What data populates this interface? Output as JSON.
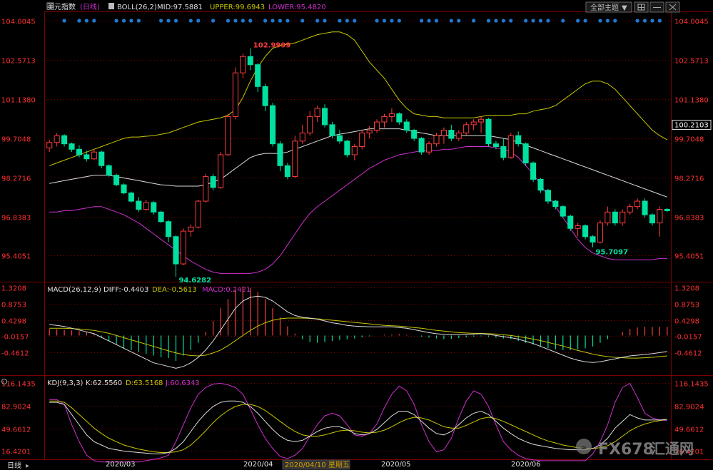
{
  "header": {
    "symbol": "美元指数",
    "period": "日线",
    "boll_label": "BOLL(26,2)",
    "mid_label": "MID:97.5881",
    "upper_label": "UPPER:99.6943",
    "lower_label": "LOWER:95.4820",
    "theme_button": "全部主题"
  },
  "colors": {
    "up": "#ff3d3d",
    "down": "#00e0a0",
    "upper": "#c8c800",
    "mid": "#dcdcdc",
    "lower": "#d030d0",
    "axis": "#ff3030",
    "grid": "#7a0000"
  },
  "chart_data": [
    {
      "type": "candlestick",
      "name": "price",
      "ylim": [
        94.5,
        104.3
      ],
      "y_ticks": [
        "104.0045",
        "102.5713",
        "101.1380",
        "99.7048",
        "98.2716",
        "96.8383",
        "95.4051"
      ],
      "current_price": "100.2103",
      "annotations": {
        "high": "102.9999",
        "low": "94.6282",
        "low2": "95.7097"
      },
      "ohlc": [
        [
          99.35,
          99.65,
          99.2,
          99.55
        ],
        [
          99.55,
          99.9,
          99.4,
          99.8
        ],
        [
          99.8,
          99.85,
          99.4,
          99.5
        ],
        [
          99.5,
          99.55,
          99.2,
          99.3
        ],
        [
          99.3,
          99.45,
          99.0,
          99.1
        ],
        [
          99.1,
          99.25,
          98.85,
          98.95
        ],
        [
          98.95,
          99.3,
          98.9,
          99.2
        ],
        [
          99.2,
          99.25,
          98.6,
          98.7
        ],
        [
          98.7,
          98.75,
          98.3,
          98.35
        ],
        [
          98.35,
          98.4,
          97.95,
          98.0
        ],
        [
          98.0,
          98.05,
          97.65,
          97.7
        ],
        [
          97.7,
          97.75,
          97.35,
          97.4
        ],
        [
          97.4,
          97.55,
          97.0,
          97.1
        ],
        [
          97.1,
          97.45,
          97.05,
          97.35
        ],
        [
          97.35,
          97.4,
          96.9,
          97.0
        ],
        [
          97.0,
          97.05,
          96.6,
          96.65
        ],
        [
          96.65,
          96.7,
          95.9,
          96.1
        ],
        [
          96.1,
          96.15,
          94.63,
          95.1
        ],
        [
          95.1,
          96.4,
          95.05,
          96.3
        ],
        [
          96.3,
          96.55,
          96.1,
          96.45
        ],
        [
          96.45,
          97.45,
          96.4,
          97.4
        ],
        [
          97.4,
          98.4,
          97.35,
          98.3
        ],
        [
          98.3,
          98.4,
          97.8,
          97.9
        ],
        [
          97.9,
          99.2,
          97.85,
          99.1
        ],
        [
          99.1,
          100.6,
          99.05,
          100.5
        ],
        [
          100.5,
          102.3,
          100.4,
          102.1
        ],
        [
          102.1,
          102.8,
          101.9,
          102.7
        ],
        [
          102.7,
          103.0,
          102.2,
          102.4
        ],
        [
          102.4,
          102.45,
          101.4,
          101.6
        ],
        [
          101.6,
          101.7,
          100.7,
          100.9
        ],
        [
          100.9,
          101.0,
          99.4,
          99.5
        ],
        [
          99.5,
          99.6,
          98.5,
          98.7
        ],
        [
          98.7,
          98.8,
          98.2,
          98.3
        ],
        [
          98.3,
          99.8,
          98.25,
          99.6
        ],
        [
          99.6,
          100.2,
          99.5,
          99.9
        ],
        [
          99.9,
          100.7,
          99.8,
          100.5
        ],
        [
          100.5,
          100.9,
          100.3,
          100.8
        ],
        [
          100.8,
          100.95,
          100.1,
          100.2
        ],
        [
          100.2,
          100.3,
          99.7,
          99.8
        ],
        [
          99.8,
          100.0,
          99.5,
          99.6
        ],
        [
          99.6,
          99.65,
          99.0,
          99.1
        ],
        [
          99.1,
          99.5,
          98.9,
          99.4
        ],
        [
          99.4,
          100.0,
          99.3,
          99.9
        ],
        [
          99.9,
          100.15,
          99.7,
          100.0
        ],
        [
          100.0,
          100.4,
          99.9,
          100.3
        ],
        [
          100.3,
          100.6,
          100.1,
          100.5
        ],
        [
          100.5,
          100.8,
          100.3,
          100.6
        ],
        [
          100.6,
          100.65,
          100.2,
          100.3
        ],
        [
          100.3,
          100.4,
          99.9,
          100.0
        ],
        [
          100.0,
          100.05,
          99.6,
          99.7
        ],
        [
          99.7,
          99.75,
          99.1,
          99.2
        ],
        [
          99.2,
          99.6,
          99.1,
          99.5
        ],
        [
          99.5,
          99.9,
          99.4,
          99.8
        ],
        [
          99.8,
          100.1,
          99.5,
          100.0
        ],
        [
          100.0,
          100.2,
          99.6,
          99.7
        ],
        [
          99.7,
          100.0,
          99.6,
          99.9
        ],
        [
          99.9,
          100.3,
          99.8,
          100.2
        ],
        [
          100.2,
          100.4,
          100.0,
          100.3
        ],
        [
          100.3,
          100.5,
          99.9,
          100.4
        ],
        [
          100.4,
          100.45,
          99.4,
          99.5
        ],
        [
          99.5,
          99.6,
          99.3,
          99.4
        ],
        [
          99.4,
          99.7,
          98.9,
          99.0
        ],
        [
          99.0,
          99.9,
          98.95,
          99.8
        ],
        [
          99.8,
          99.95,
          99.4,
          99.5
        ],
        [
          99.5,
          99.55,
          98.7,
          98.8
        ],
        [
          98.8,
          98.85,
          98.1,
          98.2
        ],
        [
          98.2,
          98.25,
          97.7,
          97.8
        ],
        [
          97.8,
          97.85,
          97.3,
          97.4
        ],
        [
          97.4,
          97.45,
          97.1,
          97.2
        ],
        [
          97.2,
          97.25,
          96.8,
          96.85
        ],
        [
          96.85,
          96.9,
          96.3,
          96.4
        ],
        [
          96.4,
          96.6,
          96.1,
          96.5
        ],
        [
          96.5,
          96.55,
          96.0,
          96.1
        ],
        [
          96.1,
          96.15,
          95.71,
          95.9
        ],
        [
          95.9,
          96.7,
          95.85,
          96.6
        ],
        [
          96.6,
          97.2,
          96.5,
          97.0
        ],
        [
          97.0,
          97.1,
          96.5,
          96.6
        ],
        [
          96.6,
          97.1,
          96.5,
          97.0
        ],
        [
          97.0,
          97.3,
          96.9,
          97.2
        ],
        [
          97.2,
          97.5,
          97.1,
          97.4
        ],
        [
          97.4,
          97.5,
          96.8,
          96.9
        ],
        [
          96.9,
          96.95,
          96.5,
          96.6
        ],
        [
          96.6,
          97.2,
          96.1,
          97.1
        ],
        [
          97.1,
          97.15,
          97.0,
          97.05
        ]
      ],
      "boll_upper": [
        98.7,
        98.8,
        98.9,
        99.0,
        99.1,
        99.2,
        99.3,
        99.4,
        99.5,
        99.6,
        99.7,
        99.75,
        99.75,
        99.78,
        99.8,
        99.85,
        99.9,
        100.0,
        100.1,
        100.2,
        100.3,
        100.35,
        100.4,
        100.45,
        100.55,
        100.75,
        101.2,
        101.8,
        102.3,
        102.7,
        103.0,
        103.1,
        103.15,
        103.2,
        103.3,
        103.4,
        103.5,
        103.55,
        103.6,
        103.6,
        103.5,
        103.3,
        102.9,
        102.5,
        102.2,
        101.9,
        101.5,
        101.1,
        100.8,
        100.6,
        100.55,
        100.5,
        100.5,
        100.45,
        100.45,
        100.45,
        100.45,
        100.45,
        100.5,
        100.55,
        100.55,
        100.55,
        100.55,
        100.6,
        100.6,
        100.7,
        100.75,
        100.8,
        100.9,
        101.1,
        101.3,
        101.5,
        101.7,
        101.8,
        101.8,
        101.7,
        101.5,
        101.2,
        100.9,
        100.6,
        100.3,
        100.0,
        99.8,
        99.65
      ],
      "boll_mid": [
        98.05,
        98.1,
        98.15,
        98.2,
        98.25,
        98.3,
        98.35,
        98.35,
        98.35,
        98.3,
        98.25,
        98.2,
        98.15,
        98.1,
        98.05,
        98.0,
        97.98,
        97.95,
        97.95,
        97.95,
        97.95,
        98.0,
        98.1,
        98.2,
        98.4,
        98.6,
        98.8,
        99.0,
        99.1,
        99.15,
        99.15,
        99.15,
        99.2,
        99.3,
        99.4,
        99.5,
        99.6,
        99.7,
        99.8,
        99.85,
        99.9,
        99.95,
        100.0,
        100.05,
        100.05,
        100.05,
        100.05,
        100.05,
        100.0,
        99.95,
        99.9,
        99.85,
        99.8,
        99.8,
        99.8,
        99.8,
        99.8,
        99.8,
        99.8,
        99.8,
        99.75,
        99.7,
        99.65,
        99.55,
        99.45,
        99.35,
        99.25,
        99.15,
        99.05,
        98.95,
        98.85,
        98.75,
        98.65,
        98.55,
        98.45,
        98.35,
        98.25,
        98.15,
        98.05,
        97.95,
        97.85,
        97.75,
        97.65,
        97.55
      ],
      "boll_lower": [
        97.0,
        97.0,
        97.05,
        97.05,
        97.1,
        97.15,
        97.2,
        97.2,
        97.1,
        97.0,
        96.9,
        96.75,
        96.6,
        96.4,
        96.2,
        96.0,
        95.8,
        95.6,
        95.4,
        95.2,
        95.05,
        94.9,
        94.8,
        94.75,
        94.75,
        94.75,
        94.75,
        94.75,
        94.8,
        94.9,
        95.1,
        95.4,
        95.8,
        96.2,
        96.6,
        96.95,
        97.2,
        97.4,
        97.6,
        97.8,
        98.0,
        98.2,
        98.4,
        98.6,
        98.75,
        98.9,
        99.0,
        99.1,
        99.15,
        99.2,
        99.25,
        99.25,
        99.25,
        99.3,
        99.3,
        99.35,
        99.4,
        99.4,
        99.4,
        99.4,
        99.35,
        99.3,
        99.2,
        99.0,
        98.7,
        98.4,
        98.0,
        97.6,
        97.2,
        96.8,
        96.4,
        96.0,
        95.7,
        95.5,
        95.4,
        95.3,
        95.25,
        95.25,
        95.25,
        95.25,
        95.25,
        95.25,
        95.3,
        95.3
      ]
    },
    {
      "type": "macd",
      "label": "MACD(26,12,9)",
      "diff_label": "DIFF:-0.4403",
      "dea_label": "DEA:-0.5613",
      "macd_label": "MACD:0.2421",
      "ylim": [
        -1.05,
        1.42
      ],
      "y_ticks": [
        "1.3208",
        "0.8753",
        "0.4298",
        "-0.0157",
        "-0.4612"
      ],
      "hist": [
        0.18,
        0.17,
        0.16,
        0.14,
        0.12,
        0.1,
        0.05,
        -0.05,
        -0.15,
        -0.25,
        -0.35,
        -0.4,
        -0.45,
        -0.5,
        -0.55,
        -0.6,
        -0.62,
        -0.7,
        -0.55,
        -0.4,
        -0.2,
        0.1,
        0.4,
        0.75,
        1.0,
        1.25,
        1.35,
        1.3,
        1.2,
        1.0,
        0.75,
        0.5,
        0.25,
        0.05,
        -0.1,
        -0.18,
        -0.2,
        -0.18,
        -0.15,
        -0.12,
        -0.1,
        -0.08,
        -0.05,
        -0.02,
        0.0,
        0.02,
        0.03,
        0.04,
        0.02,
        0.0,
        -0.03,
        -0.06,
        -0.08,
        -0.1,
        -0.09,
        -0.07,
        -0.05,
        -0.03,
        -0.02,
        -0.04,
        -0.06,
        -0.08,
        -0.1,
        -0.15,
        -0.2,
        -0.25,
        -0.3,
        -0.35,
        -0.38,
        -0.4,
        -0.4,
        -0.38,
        -0.35,
        -0.3,
        -0.2,
        -0.1,
        0.0,
        0.1,
        0.18,
        0.22,
        0.24,
        0.24,
        0.24,
        0.24
      ],
      "diff": [
        0.3,
        0.28,
        0.25,
        0.2,
        0.15,
        0.1,
        0.05,
        -0.05,
        -0.15,
        -0.25,
        -0.35,
        -0.45,
        -0.55,
        -0.65,
        -0.75,
        -0.8,
        -0.85,
        -0.9,
        -0.85,
        -0.75,
        -0.6,
        -0.4,
        -0.15,
        0.15,
        0.45,
        0.75,
        0.95,
        1.05,
        1.08,
        1.05,
        0.95,
        0.8,
        0.65,
        0.55,
        0.5,
        0.48,
        0.45,
        0.4,
        0.35,
        0.32,
        0.28,
        0.26,
        0.25,
        0.24,
        0.24,
        0.24,
        0.24,
        0.22,
        0.2,
        0.16,
        0.12,
        0.08,
        0.05,
        0.03,
        0.02,
        0.02,
        0.03,
        0.04,
        0.05,
        0.03,
        0.0,
        -0.03,
        -0.06,
        -0.1,
        -0.16,
        -0.22,
        -0.3,
        -0.38,
        -0.46,
        -0.54,
        -0.62,
        -0.68,
        -0.72,
        -0.74,
        -0.72,
        -0.68,
        -0.64,
        -0.6,
        -0.56,
        -0.54,
        -0.52,
        -0.5,
        -0.47,
        -0.44
      ],
      "dea": [
        0.2,
        0.2,
        0.2,
        0.19,
        0.18,
        0.16,
        0.14,
        0.1,
        0.06,
        0.0,
        -0.06,
        -0.12,
        -0.18,
        -0.24,
        -0.3,
        -0.36,
        -0.42,
        -0.48,
        -0.52,
        -0.55,
        -0.56,
        -0.54,
        -0.48,
        -0.4,
        -0.28,
        -0.14,
        0.0,
        0.14,
        0.26,
        0.35,
        0.42,
        0.46,
        0.48,
        0.48,
        0.48,
        0.47,
        0.46,
        0.44,
        0.42,
        0.4,
        0.38,
        0.36,
        0.34,
        0.32,
        0.3,
        0.28,
        0.27,
        0.26,
        0.24,
        0.22,
        0.2,
        0.17,
        0.14,
        0.12,
        0.1,
        0.08,
        0.07,
        0.06,
        0.06,
        0.05,
        0.04,
        0.02,
        0.0,
        -0.03,
        -0.06,
        -0.1,
        -0.14,
        -0.19,
        -0.24,
        -0.29,
        -0.35,
        -0.41,
        -0.46,
        -0.51,
        -0.55,
        -0.58,
        -0.6,
        -0.61,
        -0.62,
        -0.62,
        -0.61,
        -0.6,
        -0.58,
        -0.56
      ]
    },
    {
      "type": "kdj",
      "label": "KDJ(9,3,3)",
      "k_label": "K:62.5560",
      "d_label": "D:63.5168",
      "j_label": "J:60.6343",
      "ylim": [
        5,
        125
      ],
      "y_ticks": [
        "116.1435",
        "82.9024",
        "49.6612",
        "16.4201"
      ],
      "k": [
        88,
        88,
        85,
        70,
        55,
        40,
        30,
        25,
        20,
        18,
        16,
        15,
        14,
        13,
        12,
        12,
        14,
        20,
        30,
        45,
        60,
        72,
        82,
        88,
        90,
        90,
        88,
        82,
        72,
        60,
        48,
        38,
        32,
        30,
        32,
        38,
        45,
        50,
        52,
        52,
        48,
        42,
        40,
        42,
        48,
        58,
        68,
        75,
        75,
        70,
        60,
        50,
        42,
        40,
        45,
        55,
        65,
        72,
        75,
        70,
        60,
        50,
        42,
        35,
        30,
        26,
        24,
        22,
        20,
        19,
        18,
        18,
        18,
        20,
        25,
        35,
        50,
        60,
        70,
        65,
        62,
        62,
        62,
        63
      ],
      "d": [
        90,
        90,
        88,
        80,
        70,
        60,
        50,
        42,
        35,
        30,
        25,
        22,
        19,
        17,
        15,
        14,
        14,
        15,
        18,
        25,
        35,
        46,
        58,
        68,
        76,
        82,
        85,
        85,
        82,
        76,
        68,
        60,
        52,
        45,
        40,
        38,
        38,
        40,
        43,
        46,
        47,
        46,
        44,
        43,
        44,
        47,
        52,
        58,
        63,
        66,
        65,
        62,
        57,
        52,
        50,
        50,
        54,
        59,
        64,
        66,
        64,
        60,
        55,
        50,
        45,
        40,
        35,
        31,
        28,
        25,
        23,
        21,
        20,
        20,
        21,
        24,
        30,
        38,
        46,
        52,
        56,
        59,
        61,
        63
      ],
      "j": [
        92,
        92,
        85,
        55,
        30,
        10,
        2,
        0,
        0,
        0,
        0,
        0,
        0,
        2,
        4,
        6,
        10,
        30,
        55,
        80,
        100,
        110,
        115,
        116,
        114,
        110,
        100,
        78,
        55,
        35,
        20,
        8,
        5,
        10,
        20,
        38,
        55,
        68,
        72,
        68,
        55,
        40,
        38,
        42,
        56,
        80,
        100,
        112,
        105,
        85,
        55,
        30,
        15,
        18,
        35,
        65,
        90,
        105,
        100,
        82,
        55,
        30,
        18,
        10,
        5,
        3,
        2,
        2,
        2,
        2,
        2,
        2,
        2,
        12,
        30,
        55,
        88,
        110,
        116,
        95,
        72,
        65,
        62,
        61
      ]
    }
  ],
  "x_axis": {
    "labels": [
      "2020/03",
      "2020/04",
      "2020/05",
      "2020/06"
    ],
    "selected_date": "2020/04/10 星期五"
  },
  "footer": {
    "period": "日线",
    "brand": "FX678",
    "brand_cn": "汇通网"
  }
}
